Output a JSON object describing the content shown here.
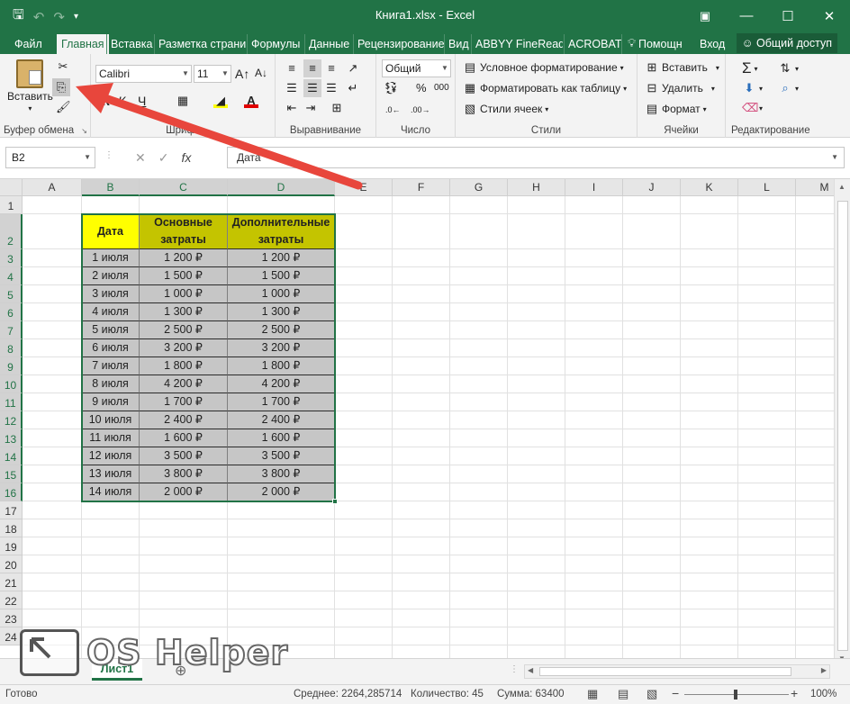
{
  "window": {
    "title": "Книга1.xlsx - Excel"
  },
  "tabs": [
    {
      "label": "Файл"
    },
    {
      "label": "Главная"
    },
    {
      "label": "Вставка"
    },
    {
      "label": "Разметка страни"
    },
    {
      "label": "Формулы"
    },
    {
      "label": "Данные"
    },
    {
      "label": "Рецензирование"
    },
    {
      "label": "Вид"
    },
    {
      "label": "ABBYY FineReade"
    },
    {
      "label": "ACROBAT"
    },
    {
      "label": "Помощн"
    },
    {
      "label": "Вход"
    }
  ],
  "share_label": "Общий доступ",
  "ribbon": {
    "clipboard": {
      "paste_label": "Вставить",
      "group_label": "Буфер обмена"
    },
    "font": {
      "font_name": "Calibri",
      "font_size": "11",
      "bold": "Ж",
      "italic": "К",
      "underline": "Ч",
      "group_label": "Шрифт"
    },
    "alignment": {
      "group_label": "Выравнивание"
    },
    "number": {
      "format": "Общий",
      "percent": "%",
      "thousands": "000",
      "group_label": "Число"
    },
    "styles": {
      "conditional": "Условное форматирование",
      "as_table": "Форматировать как таблицу",
      "cell_styles": "Стили ячеек",
      "group_label": "Стили"
    },
    "cells": {
      "insert": "Вставить",
      "delete": "Удалить",
      "format": "Формат",
      "group_label": "Ячейки"
    },
    "editing": {
      "group_label": "Редактирование"
    }
  },
  "formula_bar": {
    "name_box": "B2",
    "fx": "fx",
    "content": "Дата"
  },
  "columns": [
    "A",
    "B",
    "C",
    "D",
    "E",
    "F",
    "G",
    "H",
    "I",
    "J",
    "K",
    "L",
    "M"
  ],
  "rows": [
    "1",
    "2",
    "3",
    "4",
    "5",
    "6",
    "7",
    "8",
    "9",
    "10",
    "11",
    "12",
    "13",
    "14",
    "15",
    "16",
    "17",
    "18",
    "19",
    "20",
    "21",
    "22",
    "23",
    "24"
  ],
  "table": {
    "headers": [
      "Дата",
      "Основные затраты",
      "Дополнительные затраты"
    ],
    "rows": [
      [
        "1 июля",
        "1 200 ₽",
        "1 200 ₽"
      ],
      [
        "2 июля",
        "1 500 ₽",
        "1 500 ₽"
      ],
      [
        "3 июля",
        "1 000 ₽",
        "1 000 ₽"
      ],
      [
        "4 июля",
        "1 300 ₽",
        "1 300 ₽"
      ],
      [
        "5 июля",
        "2 500 ₽",
        "2 500 ₽"
      ],
      [
        "6 июля",
        "3 200 ₽",
        "3 200 ₽"
      ],
      [
        "7 июля",
        "1 800 ₽",
        "1 800 ₽"
      ],
      [
        "8 июля",
        "4 200 ₽",
        "4 200 ₽"
      ],
      [
        "9 июля",
        "1 700 ₽",
        "1 700 ₽"
      ],
      [
        "10 июля",
        "2 400 ₽",
        "2 400 ₽"
      ],
      [
        "11 июля",
        "1 600 ₽",
        "1 600 ₽"
      ],
      [
        "12 июля",
        "3 500 ₽",
        "3 500 ₽"
      ],
      [
        "13 июля",
        "3 800 ₽",
        "3 800 ₽"
      ],
      [
        "14 июля",
        "2 000 ₽",
        "2 000 ₽"
      ]
    ]
  },
  "sheet_tab": "Лист1",
  "status": {
    "ready": "Готово",
    "average": "Среднее: 2264,285714",
    "count": "Количество: 45",
    "sum": "Сумма: 63400",
    "zoom": "100%"
  },
  "watermark": "OS Helper",
  "colors": {
    "accent": "#217346",
    "header_yellow": "#ffff00",
    "header_olive": "#c4c400",
    "body_gray": "#c6c6c6",
    "arrow": "#e8463c"
  }
}
